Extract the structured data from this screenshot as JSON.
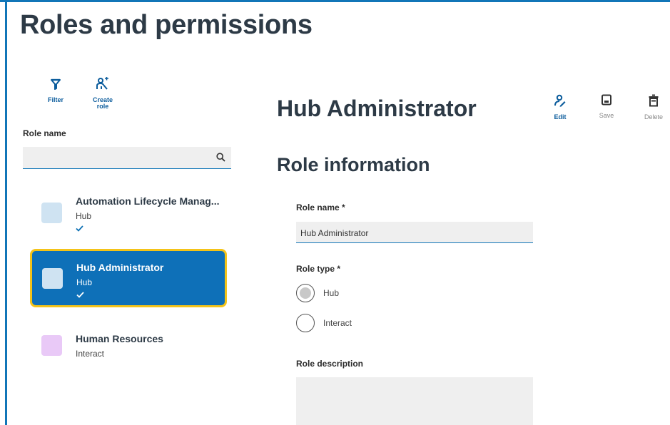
{
  "page": {
    "title": "Roles and permissions"
  },
  "toolbar": {
    "filter_label": "Filter",
    "create_label_line1": "Create",
    "create_label_line2": "role"
  },
  "search": {
    "label": "Role name",
    "value": "",
    "placeholder": ""
  },
  "roles": [
    {
      "name": "Automation Lifecycle Manag...",
      "type": "Hub",
      "checked": true,
      "selected": false,
      "color": "#cfe3f2"
    },
    {
      "name": "Hub Administrator",
      "type": "Hub",
      "checked": true,
      "selected": true,
      "color": "#cfe3f2"
    },
    {
      "name": "Human Resources",
      "type": "Interact",
      "checked": false,
      "selected": false,
      "color": "#e9c9f7"
    }
  ],
  "detail": {
    "title": "Hub Administrator",
    "actions": {
      "edit": "Edit",
      "save": "Save",
      "delete": "Delete"
    },
    "section_title": "Role information",
    "role_name_label": "Role name *",
    "role_name_value": "Hub Administrator",
    "role_type_label": "Role type *",
    "role_type_options": [
      "Hub",
      "Interact"
    ],
    "role_type_selected": "Hub",
    "role_description_label": "Role description",
    "role_description_value": ""
  },
  "colors": {
    "accent": "#1176b8",
    "selected_bg": "#0e70b8",
    "selected_border": "#f4c318",
    "title_text": "#2d3a46"
  },
  "icons": [
    "filter-icon",
    "create-role-icon",
    "search-icon",
    "check-icon",
    "edit-icon",
    "save-icon",
    "delete-icon"
  ]
}
